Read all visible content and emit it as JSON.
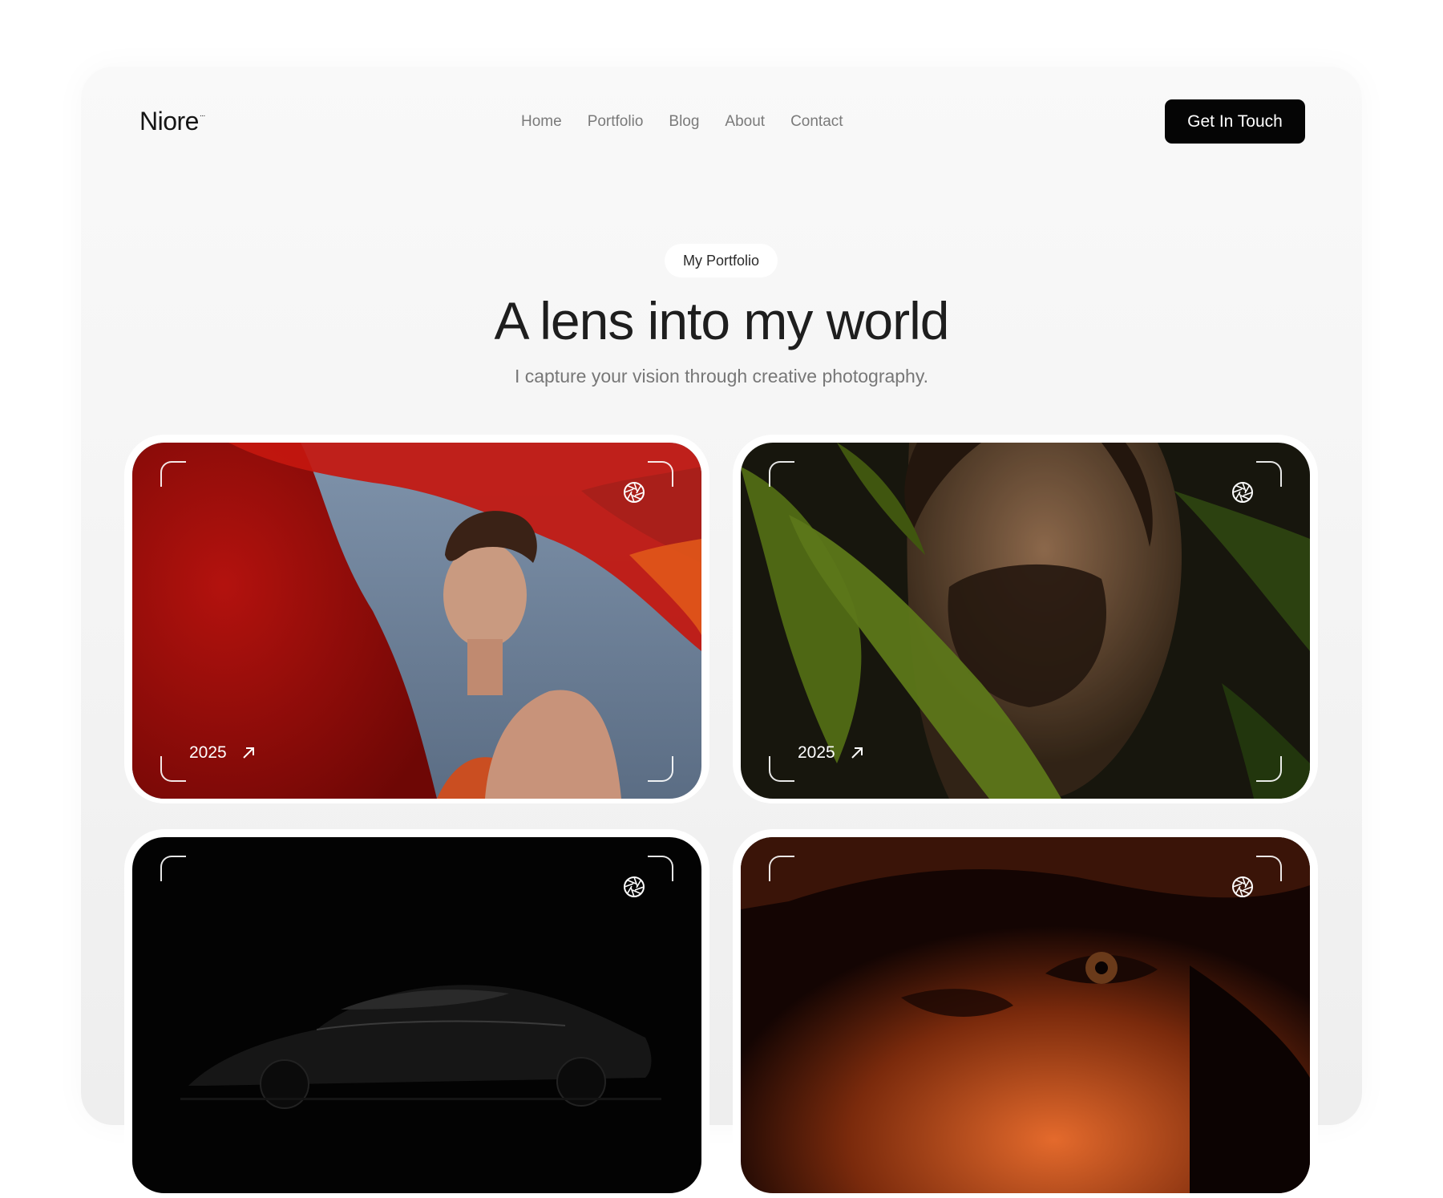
{
  "brand": {
    "name": "Niore",
    "mark": "..."
  },
  "nav": {
    "items": [
      "Home",
      "Portfolio",
      "Blog",
      "About",
      "Contact"
    ]
  },
  "header": {
    "cta_label": "Get In Touch"
  },
  "hero": {
    "tag": "My Portfolio",
    "title": "A lens into my world",
    "subtitle": "I capture your vision through creative photography."
  },
  "portfolio": {
    "cards": [
      {
        "year": "2025",
        "subject": "man-red-fabric-photo",
        "colors": [
          "#c01812",
          "#6b7c91"
        ]
      },
      {
        "year": "2025",
        "subject": "man-green-leaves-photo",
        "colors": [
          "#3a4a12",
          "#8a6a4a"
        ]
      },
      {
        "year": "",
        "subject": "black-car-photo",
        "colors": [
          "#050505",
          "#1a1a1a"
        ]
      },
      {
        "year": "",
        "subject": "man-orange-light-photo",
        "colors": [
          "#2a0c04",
          "#d4582a"
        ]
      }
    ]
  }
}
